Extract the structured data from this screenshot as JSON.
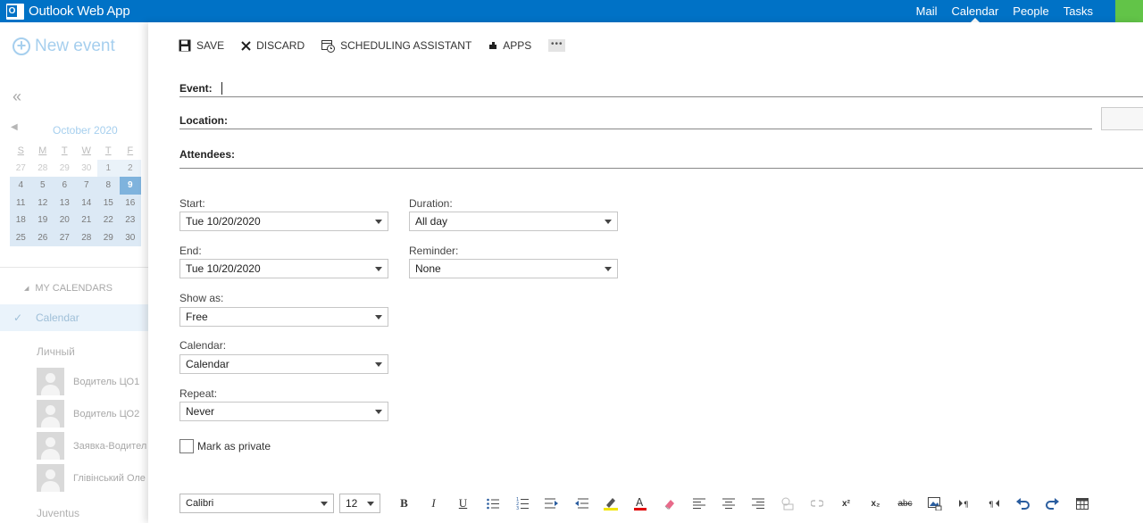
{
  "app": {
    "title": "Outlook Web App",
    "logo_letter": "O"
  },
  "topnav": {
    "items": [
      {
        "label": "Mail"
      },
      {
        "label": "Calendar",
        "active": true
      },
      {
        "label": "People"
      },
      {
        "label": "Tasks"
      }
    ]
  },
  "sidebar": {
    "new_event": "New event",
    "collapse": "«",
    "mini_calendar": {
      "month": "October 2020",
      "weekdays": [
        "S",
        "M",
        "T",
        "W",
        "T",
        "F"
      ],
      "weeks": [
        [
          "27",
          "28",
          "29",
          "30",
          "1",
          "2"
        ],
        [
          "4",
          "5",
          "6",
          "7",
          "8",
          "9"
        ],
        [
          "11",
          "12",
          "13",
          "14",
          "15",
          "16"
        ],
        [
          "18",
          "19",
          "20",
          "21",
          "22",
          "23"
        ],
        [
          "25",
          "26",
          "27",
          "28",
          "29",
          "30"
        ]
      ],
      "today": "9"
    },
    "my_calendars": "MY CALENDARS",
    "active_calendar": "Calendar",
    "group": "Личный",
    "people": [
      {
        "name": "Водитель ЦО1"
      },
      {
        "name": "Водитель ЦО2"
      },
      {
        "name": "Заявка-Водител"
      },
      {
        "name": "Глівінський Оле"
      }
    ],
    "group2": "Juventus"
  },
  "toolbar": {
    "save": "SAVE",
    "discard": "DISCARD",
    "scheduling": "SCHEDULING ASSISTANT",
    "apps": "APPS",
    "more": "•••"
  },
  "form": {
    "event_label": "Event:",
    "location_label": "Location:",
    "attendees_label": "Attendees:",
    "start_label": "Start:",
    "start_value": "Tue 10/20/2020",
    "end_label": "End:",
    "end_value": "Tue 10/20/2020",
    "duration_label": "Duration:",
    "duration_value": "All day",
    "reminder_label": "Reminder:",
    "reminder_value": "None",
    "showas_label": "Show as:",
    "showas_value": "Free",
    "calendar_label": "Calendar:",
    "calendar_value": "Calendar",
    "repeat_label": "Repeat:",
    "repeat_value": "Never",
    "private_label": "Mark as private"
  },
  "format_bar": {
    "font": "Calibri",
    "size": "12",
    "bold": "B",
    "italic": "I",
    "underline": "U",
    "superscript": "x²",
    "subscript": "x₂",
    "strikethrough": "abc"
  },
  "colors": {
    "brand": "#0072c6",
    "accent_green": "#62c448",
    "today": "#7fb3dd",
    "selection": "#dce9f5"
  }
}
